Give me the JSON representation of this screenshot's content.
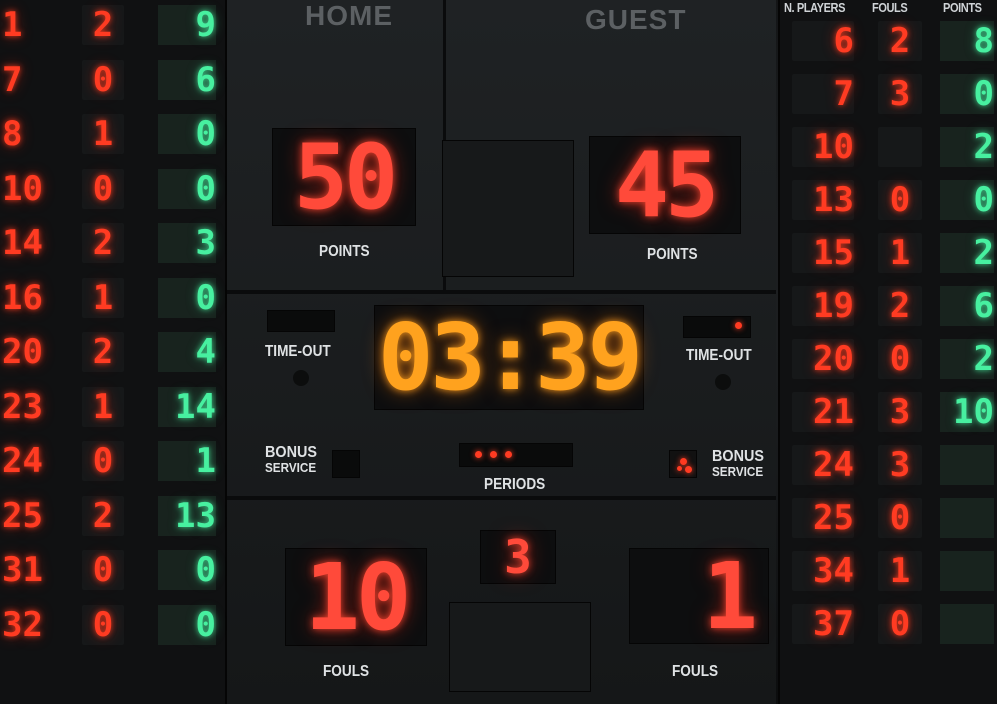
{
  "labels": {
    "home": "HOME",
    "guest": "GUEST",
    "points_home": "POINTS",
    "points_guest": "POINTS",
    "timeout_home": "TIME-OUT",
    "timeout_guest": "TIME-OUT",
    "bonus_home": "BONUS",
    "service_home": "SERVICE",
    "bonus_guest": "BONUS",
    "service_guest": "SERVICE",
    "periods": "PERIODS",
    "fouls_home": "FOULS",
    "fouls_guest": "FOULS"
  },
  "guest_headers": {
    "players": "N. PLAYERS",
    "fouls": "FOULS",
    "points": "POINTS"
  },
  "score": {
    "home": "50",
    "guest": "45"
  },
  "clock": "03:39",
  "period": "3",
  "team_fouls": {
    "home": "10",
    "guest": "1"
  },
  "home_players": [
    {
      "num": "1",
      "fouls": "2",
      "points": "9"
    },
    {
      "num": "7",
      "fouls": "0",
      "points": "6"
    },
    {
      "num": "8",
      "fouls": "1",
      "points": "0"
    },
    {
      "num": "10",
      "fouls": "0",
      "points": "0"
    },
    {
      "num": "14",
      "fouls": "2",
      "points": "3"
    },
    {
      "num": "16",
      "fouls": "1",
      "points": "0"
    },
    {
      "num": "20",
      "fouls": "2",
      "points": "4"
    },
    {
      "num": "23",
      "fouls": "1",
      "points": "14"
    },
    {
      "num": "24",
      "fouls": "0",
      "points": "1"
    },
    {
      "num": "25",
      "fouls": "2",
      "points": "13"
    },
    {
      "num": "31",
      "fouls": "0",
      "points": "0"
    },
    {
      "num": "32",
      "fouls": "0",
      "points": "0"
    }
  ],
  "guest_players": [
    {
      "num": "6",
      "fouls": "2",
      "points": "8"
    },
    {
      "num": "7",
      "fouls": "3",
      "points": "0"
    },
    {
      "num": "10",
      "fouls": "",
      "points": "2"
    },
    {
      "num": "13",
      "fouls": "0",
      "points": "0"
    },
    {
      "num": "15",
      "fouls": "1",
      "points": "2"
    },
    {
      "num": "19",
      "fouls": "2",
      "points": "6"
    },
    {
      "num": "20",
      "fouls": "0",
      "points": "2"
    },
    {
      "num": "21",
      "fouls": "3",
      "points": "10"
    },
    {
      "num": "24",
      "fouls": "3",
      "points": ""
    },
    {
      "num": "25",
      "fouls": "0",
      "points": ""
    },
    {
      "num": "34",
      "fouls": "1",
      "points": ""
    },
    {
      "num": "37",
      "fouls": "0",
      "points": ""
    }
  ]
}
